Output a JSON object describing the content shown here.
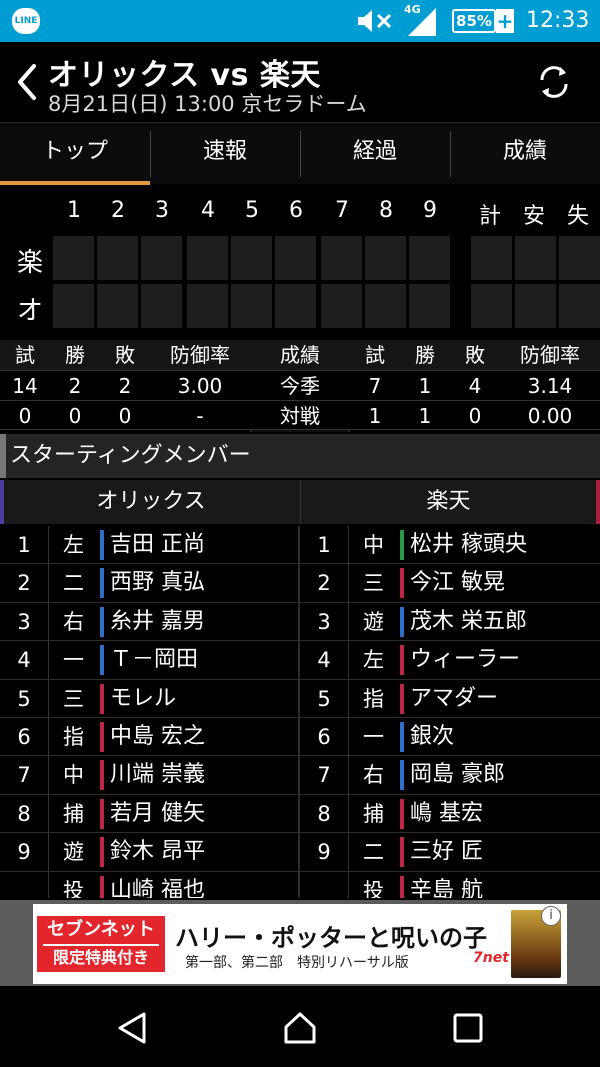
{
  "status_bar": {
    "app_icon_label": "LINE",
    "network_label": "4G",
    "battery": "85%",
    "time": "12:33"
  },
  "header": {
    "title": "オリックス vs 楽天",
    "subtitle": "8月21日(日) 13:00 京セラドーム"
  },
  "tabs": [
    {
      "label": "トップ",
      "active": true
    },
    {
      "label": "速報",
      "active": false
    },
    {
      "label": "経過",
      "active": false
    },
    {
      "label": "成績",
      "active": false
    }
  ],
  "scoreboard": {
    "innings": [
      "1",
      "2",
      "3",
      "4",
      "5",
      "6",
      "7",
      "8",
      "9"
    ],
    "totals": [
      "計",
      "安",
      "失"
    ],
    "teams": [
      "楽",
      "オ"
    ]
  },
  "stats": {
    "headers_left": [
      "試",
      "勝",
      "敗",
      "防御率"
    ],
    "header_mid": "成績",
    "headers_right": [
      "試",
      "勝",
      "敗",
      "防御率"
    ],
    "rows": [
      {
        "left": [
          "14",
          "2",
          "2",
          "3.00"
        ],
        "label": "今季",
        "right": [
          "7",
          "1",
          "4",
          "3.14"
        ]
      },
      {
        "left": [
          "0",
          "0",
          "0",
          "-"
        ],
        "label": "対戦",
        "right": [
          "1",
          "1",
          "0",
          "0.00"
        ]
      }
    ]
  },
  "section_title": "スターティングメンバー",
  "lineup": {
    "home_team": "オリックス",
    "away_team": "楽天",
    "rows": [
      {
        "left": {
          "order": "1",
          "pos": "左",
          "name": "吉田 正尚",
          "color": "#2f6fc6"
        },
        "right": {
          "order": "1",
          "pos": "中",
          "name": "松井 稼頭央",
          "color": "#2a9a4a"
        }
      },
      {
        "left": {
          "order": "2",
          "pos": "二",
          "name": "西野 真弘",
          "color": "#2f6fc6"
        },
        "right": {
          "order": "2",
          "pos": "三",
          "name": "今江 敏晃",
          "color": "#c0264a"
        }
      },
      {
        "left": {
          "order": "3",
          "pos": "右",
          "name": "糸井 嘉男",
          "color": "#2f6fc6"
        },
        "right": {
          "order": "3",
          "pos": "遊",
          "name": "茂木 栄五郎",
          "color": "#2f6fc6"
        }
      },
      {
        "left": {
          "order": "4",
          "pos": "一",
          "name": "Ｔ－岡田",
          "color": "#2f6fc6"
        },
        "right": {
          "order": "4",
          "pos": "左",
          "name": "ウィーラー",
          "color": "#c0264a"
        }
      },
      {
        "left": {
          "order": "5",
          "pos": "三",
          "name": "モレル",
          "color": "#c0264a"
        },
        "right": {
          "order": "5",
          "pos": "指",
          "name": "アマダー",
          "color": "#c0264a"
        }
      },
      {
        "left": {
          "order": "6",
          "pos": "指",
          "name": "中島 宏之",
          "color": "#c0264a"
        },
        "right": {
          "order": "6",
          "pos": "一",
          "name": "銀次",
          "color": "#2f6fc6"
        }
      },
      {
        "left": {
          "order": "7",
          "pos": "中",
          "name": "川端 崇義",
          "color": "#c0264a"
        },
        "right": {
          "order": "7",
          "pos": "右",
          "name": "岡島 豪郎",
          "color": "#2f6fc6"
        }
      },
      {
        "left": {
          "order": "8",
          "pos": "捕",
          "name": "若月 健矢",
          "color": "#c0264a"
        },
        "right": {
          "order": "8",
          "pos": "捕",
          "name": "嶋 基宏",
          "color": "#c0264a"
        }
      },
      {
        "left": {
          "order": "9",
          "pos": "遊",
          "name": "鈴木 昂平",
          "color": "#c0264a"
        },
        "right": {
          "order": "9",
          "pos": "二",
          "name": "三好 匠",
          "color": "#c0264a"
        }
      },
      {
        "left": {
          "order": "",
          "pos": "投",
          "name": "山崎 福也",
          "color": "#c0264a"
        },
        "right": {
          "order": "",
          "pos": "投",
          "name": "辛島 航",
          "color": "#c0264a"
        }
      }
    ]
  },
  "ad": {
    "badge_line1": "セブンネット",
    "badge_line2": "限定特典付き",
    "title": "ハリー・ポッターと呪いの子",
    "subtitle": "第一部、第二部　特別リハーサル版",
    "brand": "7net",
    "info": "i"
  },
  "colors": {
    "status_bar": "#009dd2",
    "tab_indicator": "#e39a3a",
    "orix_accent": "#4a3d9e",
    "rakuten_accent": "#a8203d"
  }
}
